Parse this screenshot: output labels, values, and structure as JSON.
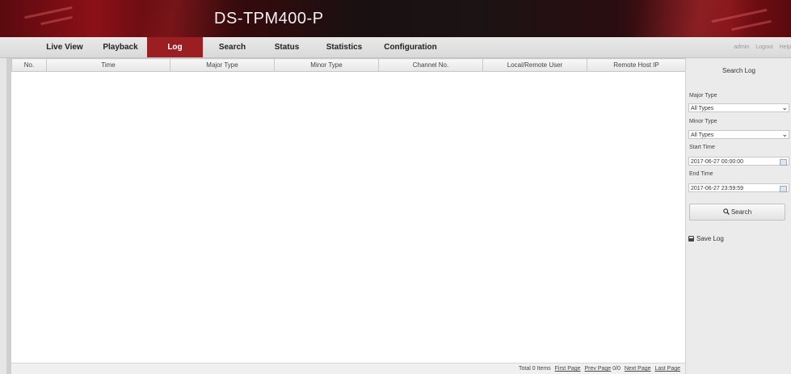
{
  "app": {
    "title": "DS-TPM400-P"
  },
  "nav": {
    "items": [
      {
        "label": "Live View"
      },
      {
        "label": "Playback"
      },
      {
        "label": "Log"
      },
      {
        "label": "Search"
      },
      {
        "label": "Status"
      },
      {
        "label": "Statistics"
      },
      {
        "label": "Configuration"
      }
    ],
    "active": "Log"
  },
  "user": {
    "name": "admin",
    "logout": "Logout",
    "help": "Help"
  },
  "table": {
    "columns": [
      "No.",
      "Time",
      "Major Type",
      "Minor Type",
      "Channel No.",
      "Local/Remote User",
      "Remote Host IP"
    ],
    "rows": []
  },
  "pagination": {
    "total": "Total 0 Items",
    "first": "First Page",
    "prev": "Prev Page",
    "page": "0/0",
    "next": "Next Page",
    "last": "Last Page"
  },
  "search_panel": {
    "title": "Search Log",
    "major_type_label": "Major Type",
    "major_type_value": "All Types",
    "minor_type_label": "Minor Type",
    "minor_type_value": "All Types",
    "start_time_label": "Start Time",
    "start_time_value": "2017-06-27 00:00:00",
    "end_time_label": "End Time",
    "end_time_value": "2017-06-27 23:59:59",
    "search_button": "Search",
    "save_log": "Save Log"
  },
  "colors": {
    "active_tab": "#9a1e22",
    "header_dark": "#1a1011",
    "header_red": "#8c1018"
  },
  "icons": {
    "search": "magnifier-icon",
    "save": "floppy-disk-icon",
    "calendar": "calendar-icon",
    "dropdown": "chevron-down-icon"
  }
}
